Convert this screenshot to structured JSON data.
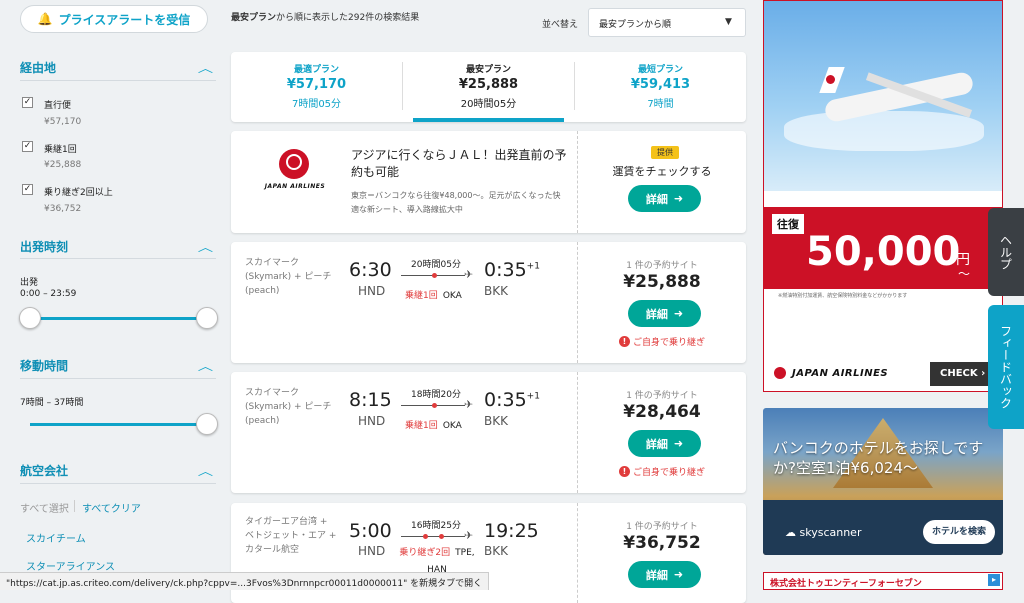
{
  "sidebar": {
    "price_alert_label": "プライスアラートを受信",
    "stops": {
      "title": "経由地",
      "options": [
        {
          "label": "直行便",
          "price": "¥57,170",
          "checked": true
        },
        {
          "label": "乗継1回",
          "price": "¥25,888",
          "checked": true
        },
        {
          "label": "乗り継ぎ2回以上",
          "price": "¥36,752",
          "checked": true
        }
      ]
    },
    "departure": {
      "title": "出発時刻",
      "label": "出発",
      "range": "0:00 – 23:59"
    },
    "duration": {
      "title": "移動時間",
      "range": "7時間 – 37時間"
    },
    "airlines": {
      "title": "航空会社",
      "select_all": "すべて選択",
      "clear_all": "すべてクリア",
      "items": [
        "スカイチーム",
        "スターアライアンス"
      ]
    }
  },
  "results_header": {
    "summary_bold": "最安プラン",
    "summary_rest": "から順に表示した292件の検索結果",
    "sort_label": "並べ替え",
    "sort_value": "最安プランから順"
  },
  "tabs": [
    {
      "label": "最適プラン",
      "price": "¥57,170",
      "time": "7時間05分",
      "color": "#0ea3c8",
      "active": false
    },
    {
      "label": "最安プラン",
      "price": "¥25,888",
      "time": "20時間05分",
      "color": "#222222",
      "active": true
    },
    {
      "label": "最短プラン",
      "price": "¥59,413",
      "time": "7時間",
      "color": "#0ea3c8",
      "active": false
    }
  ],
  "ad_card": {
    "airline": "JAPAN AIRLINES",
    "headline": "アジアに行くならＪＡＬ！出発直前の予約も可能",
    "body": "東京＝バンコクなら往復¥48,000〜。足元が広くなった快適な新シート、導入路線拡大中",
    "badge": "提供",
    "cta_text": "運賃をチェックする",
    "button": "詳細"
  },
  "results": [
    {
      "airline": "スカイマーク(Skymark) + ピーチ(peach)",
      "dep_time": "6:30",
      "dep_code": "HND",
      "duration": "20時間05分",
      "stop_label": "乗継1回",
      "stop_city": "OKA",
      "arr_time": "0:35",
      "arr_sup": "+1",
      "arr_code": "BKK",
      "sites": "1 件の予約サイト",
      "price": "¥25,888",
      "button": "詳細",
      "self_transfer": "ご自身で乗り継ぎ"
    },
    {
      "airline": "スカイマーク(Skymark) + ピーチ(peach)",
      "dep_time": "8:15",
      "dep_code": "HND",
      "duration": "18時間20分",
      "stop_label": "乗継1回",
      "stop_city": "OKA",
      "arr_time": "0:35",
      "arr_sup": "+1",
      "arr_code": "BKK",
      "sites": "1 件の予約サイト",
      "price": "¥28,464",
      "button": "詳細",
      "self_transfer": "ご自身で乗り継ぎ"
    },
    {
      "airline": "タイガーエア台湾 + ベトジェット・エア + カタール航空",
      "dep_time": "5:00",
      "dep_code": "HND",
      "duration": "16時間25分",
      "stop_label": "乗り継ぎ2回",
      "stop_city": "TPE, HAN",
      "arr_time": "19:25",
      "arr_sup": "",
      "arr_code": "BKK",
      "sites": "1 件の予約サイト",
      "price": "¥36,752",
      "button": "詳細",
      "self_transfer": ""
    }
  ],
  "jal_banner": {
    "round_trip": "往復",
    "price": "50,000",
    "yen": "円",
    "tilde": "〜",
    "note": "※燃油特別付加運賃、航空保険特別料金などがかかります",
    "brand": "JAPAN AIRLINES",
    "check": "CHECK"
  },
  "sky_banner": {
    "headline": "バンコクのホテルをお探しですか?空室1泊¥6,024〜",
    "brand": "skyscanner",
    "button": "ホテルを検索"
  },
  "bottom_ad": "株式会社トゥエンティーフォーセブン",
  "side_tabs": {
    "help": "ヘルプ",
    "feedback": "フィードバック"
  },
  "status_bar": "\"https://cat.jp.as.criteo.com/delivery/ck.php?cppv=...3Fvos%3Dnrnnpcr00011d0000011\" を新規タブで開く",
  "colors": {
    "accent": "#0ea3c8",
    "green": "#00a698",
    "red": "#e03c3c",
    "jal_red": "#cc1126"
  }
}
